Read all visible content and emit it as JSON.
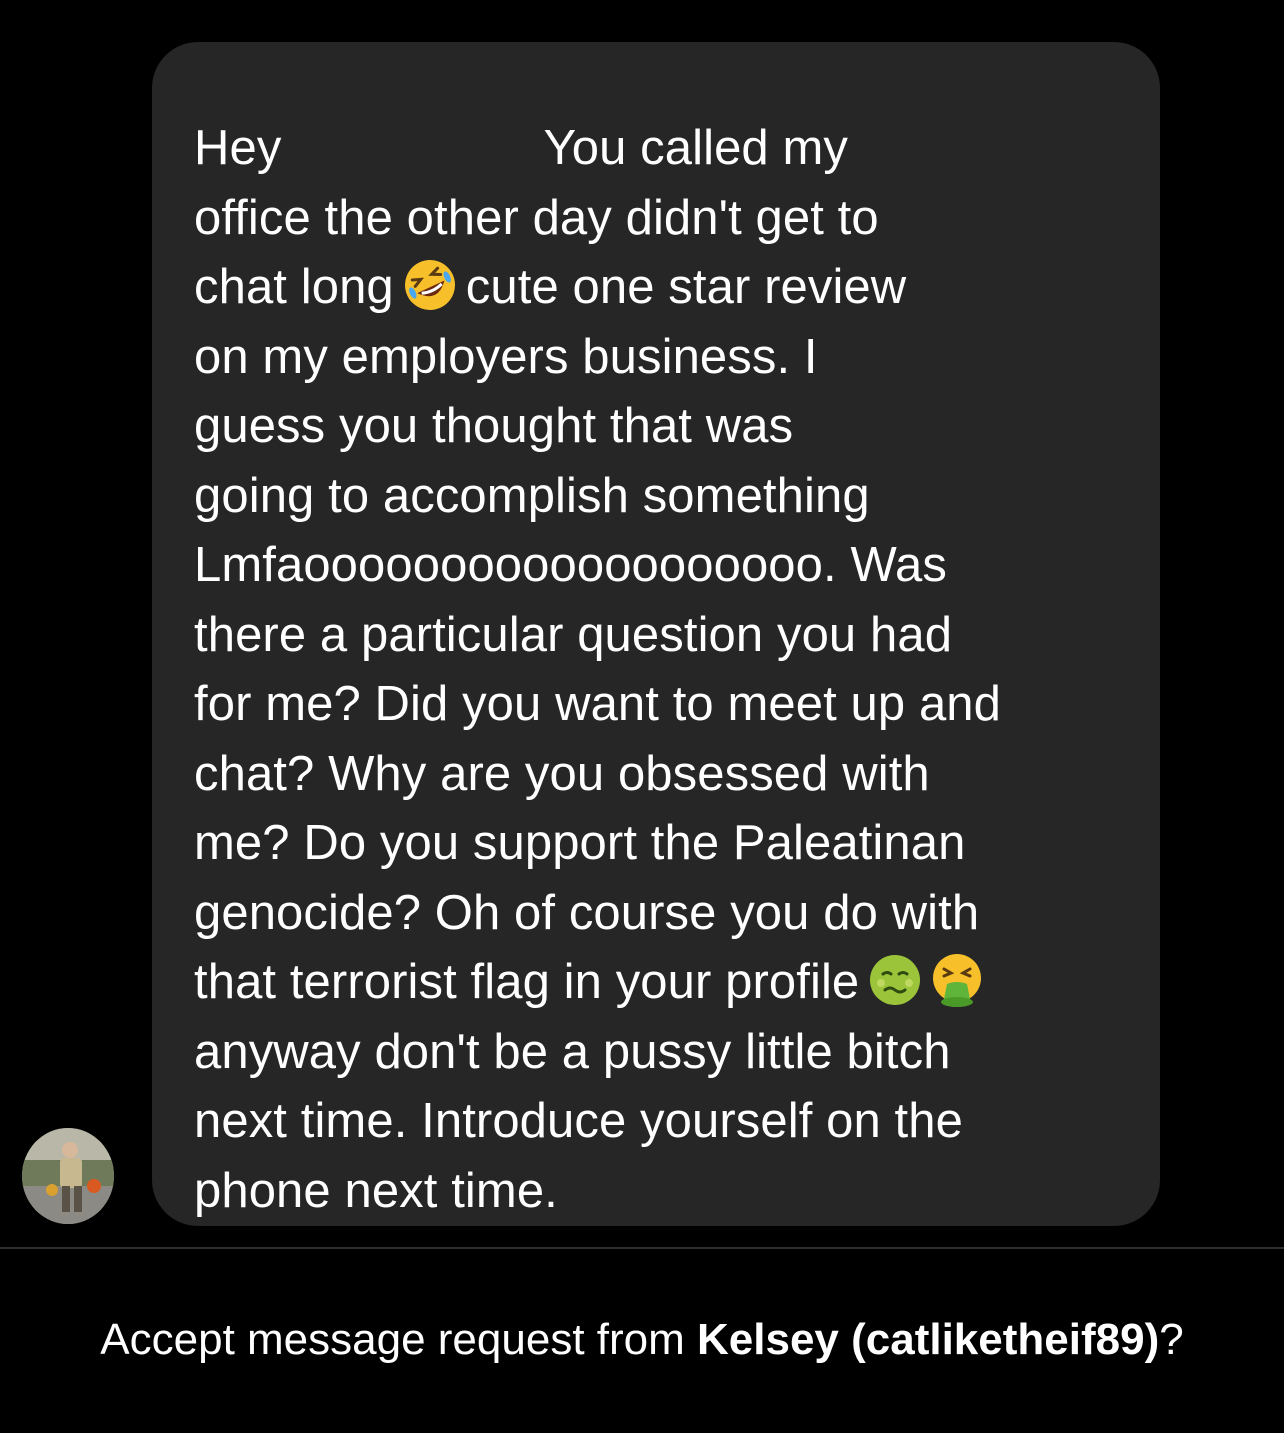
{
  "conversation": {
    "message": {
      "line1_a": "Hey",
      "line1_b": "You called my",
      "line2": "office the other day didn't get to",
      "line3_a": "chat long",
      "line3_b": "cute one star review",
      "line4": "on my employers business. I",
      "line5": "guess you thought that was",
      "line6": "going to accomplish something",
      "line7": "Lmfaooooooooooooooooooo. Was",
      "line8": "there a particular question you had",
      "line9": "for me? Did you want to meet up and",
      "line10": "chat? Why are you obsessed with",
      "line11": "me? Do you support the Paleatinan",
      "line12": "genocide? Oh of course you do with",
      "line13": "that terrorist flag in your profile",
      "line14": "anyway don't be a pussy little bitch",
      "line15": "next time. Introduce yourself on the",
      "line16": "phone next time.",
      "emojis": [
        "rolling-on-floor-laughing",
        "nauseated-face",
        "face-vomiting"
      ]
    },
    "sender_avatar": "avatar-photo"
  },
  "request_prompt": {
    "prefix": "Accept message request from",
    "name": "Kelsey (catliketheif89)",
    "suffix": "?"
  },
  "colors": {
    "background": "#000000",
    "bubble": "#262626",
    "text": "#ffffff",
    "divider": "#2e2e2e"
  }
}
